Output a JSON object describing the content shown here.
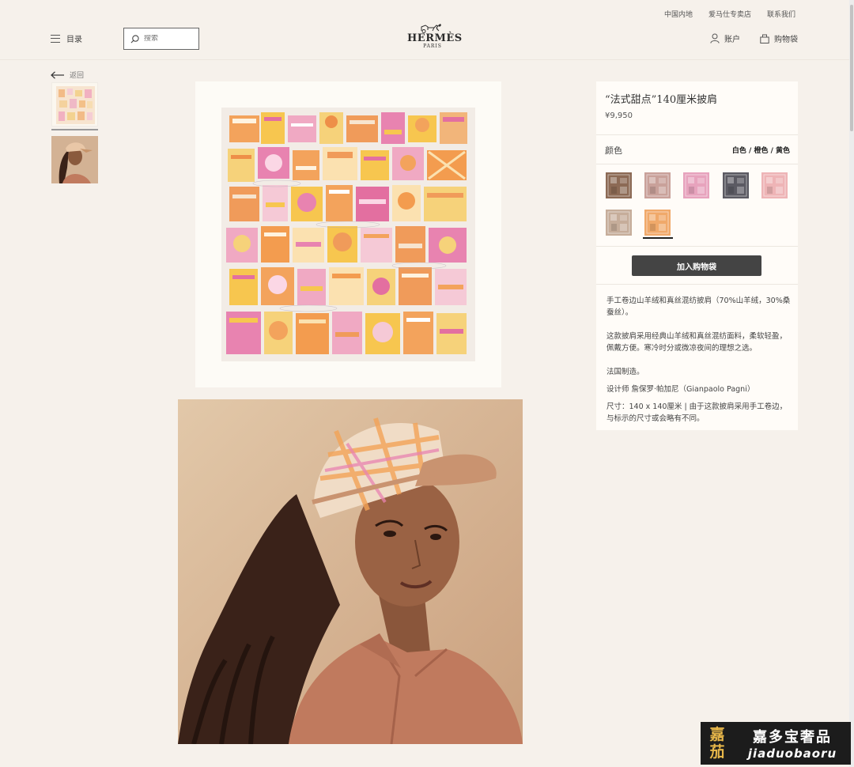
{
  "header": {
    "top_links": [
      "中国内地",
      "爱马仕专卖店",
      "联系我们"
    ],
    "menu_label": "目录",
    "search_placeholder": "搜索",
    "logo_brand": "HERMÈS",
    "logo_city": "PARIS",
    "account_label": "账户",
    "cart_label": "购物袋"
  },
  "nav": {
    "back_label": "返回"
  },
  "product": {
    "title": "“法式甜点”140厘米披肩",
    "price": "¥9,950",
    "color_label": "颜色",
    "color_value": "白色 / 橙色 / 黄色",
    "swatch_colors": [
      "#8c6a55",
      "#c9a19a",
      "#e7a3bd",
      "#5b5a63",
      "#eeb4b6",
      "#c6ad9a",
      "#f0a96a"
    ],
    "selected_swatch": 7,
    "add_to_cart_label": "加入购物袋",
    "description": {
      "material": "手工卷边山羊绒和真丝混纺披肩（70%山羊绒，30%桑蚕丝）。",
      "detail": "这款披肩采用经典山羊绒和真丝混纺面料，柔软轻盈，佩戴方便。寒冷时分或微凉夜间的理想之选。",
      "origin": "法国制造。",
      "designer": "设计师 詹保罗·帕加尼（Gianpaolo Pagni）",
      "size": "尺寸：140 x 140厘米 | 由于这款披肩采用手工卷边，与标示的尺寸或会略有不同。"
    }
  },
  "watermark": {
    "seal_top": "嘉",
    "seal_bottom": "茄",
    "name_cn": "嘉多宝奢品",
    "name_en": "jiaduobaoru"
  }
}
